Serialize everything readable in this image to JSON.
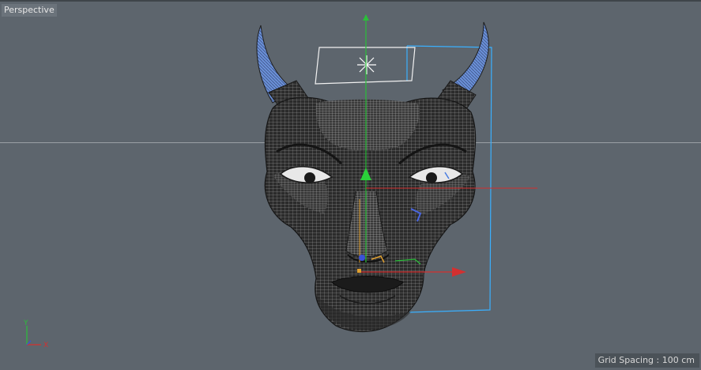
{
  "viewport": {
    "label": "Perspective",
    "grid_spacing_label": "Grid Spacing",
    "grid_spacing_separator": " : ",
    "grid_spacing_value": "100 cm"
  },
  "axes": {
    "y_label": "Y",
    "x_label": "X"
  },
  "colors": {
    "background": "#5d656d",
    "mesh_dark": "#2a2a2a",
    "mesh_line": "#b8b8b8",
    "horn_blue": "#6a90d8",
    "axis_x": "#d43030",
    "axis_y": "#2bbf3a",
    "axis_z": "#3a52d8",
    "selection": "#3ab0ff",
    "light_gizmo": "#ffffff"
  }
}
